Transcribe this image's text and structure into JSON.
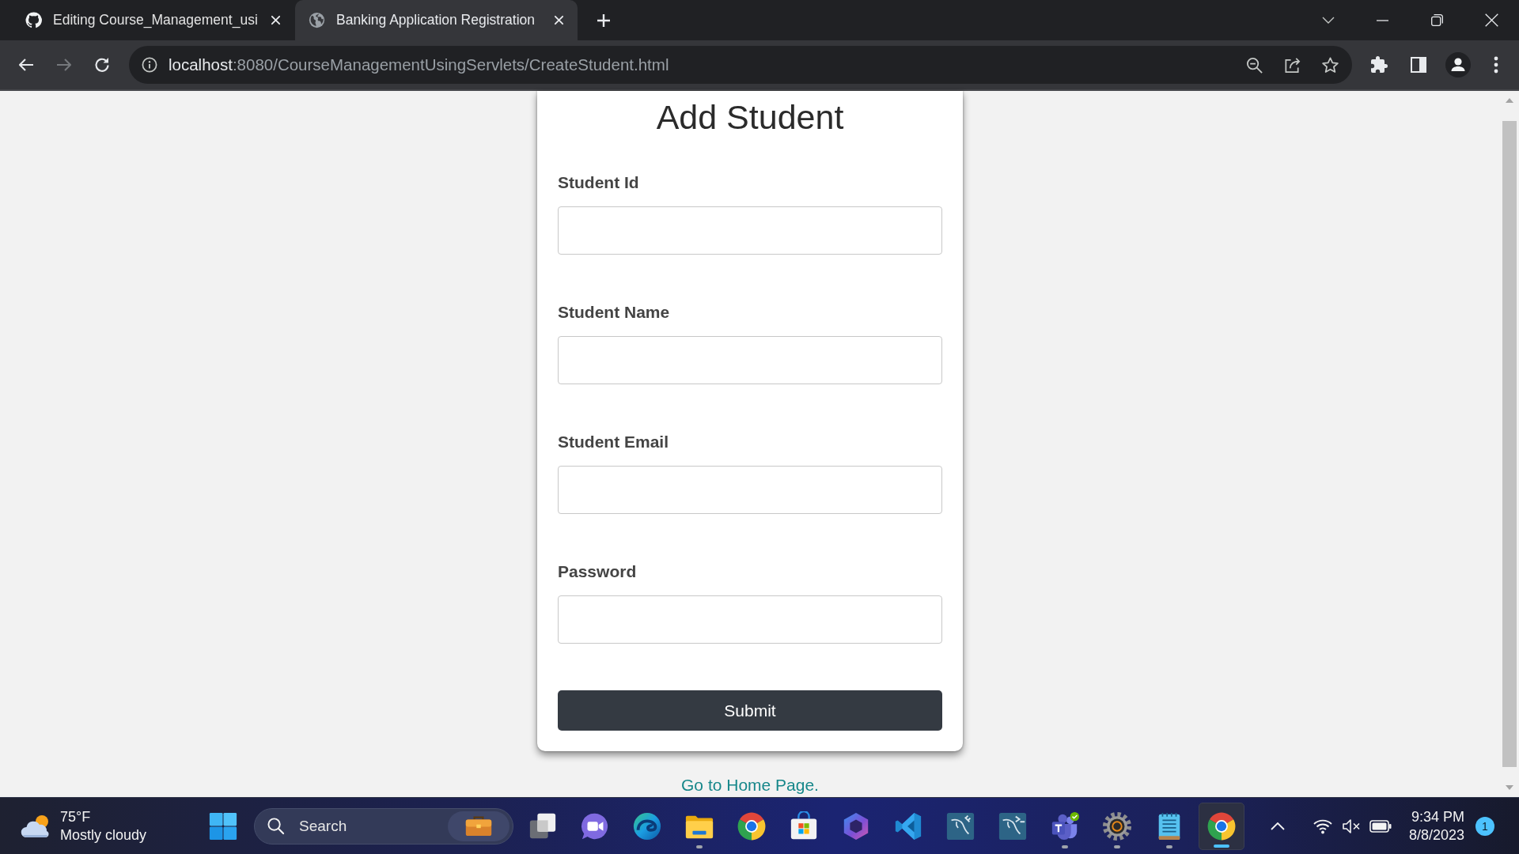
{
  "browser": {
    "tabs": [
      {
        "title": "Editing Course_Management_usi",
        "selected": false
      },
      {
        "title": "Banking Application Registration",
        "selected": true
      }
    ],
    "forward_button": {
      "disabled": true
    },
    "address_bar": {
      "host": "localhost",
      "path": ":8080/CourseManagementUsingServlets/CreateStudent.html"
    }
  },
  "form": {
    "title": "Add Student",
    "fields": [
      {
        "label": "Student Id"
      },
      {
        "label": "Student Name"
      },
      {
        "label": "Student Email"
      },
      {
        "label": "Password"
      }
    ],
    "submit": "Submit"
  },
  "home_link": "Go to Home Page.",
  "taskbar": {
    "weather": {
      "temperature": "75°F",
      "condition": "Mostly cloudy"
    },
    "search": {
      "placeholder": "Search"
    },
    "apps": [
      {
        "running": false,
        "selected": false
      },
      {
        "running": false,
        "selected": false
      },
      {
        "running": false,
        "selected": false
      },
      {
        "running": true,
        "selected": false
      },
      {
        "running": false,
        "selected": false
      },
      {
        "running": false,
        "selected": false
      },
      {
        "running": false,
        "selected": false
      },
      {
        "running": false,
        "selected": false
      },
      {
        "running": false,
        "selected": false
      },
      {
        "running": false,
        "selected": false
      },
      {
        "running": true,
        "selected": false
      },
      {
        "running": true,
        "selected": false
      },
      {
        "running": true,
        "selected": false
      },
      {
        "running": true,
        "selected": true
      }
    ],
    "clock": {
      "time": "9:34 PM",
      "date": "8/8/2023"
    },
    "notifications": "1"
  }
}
